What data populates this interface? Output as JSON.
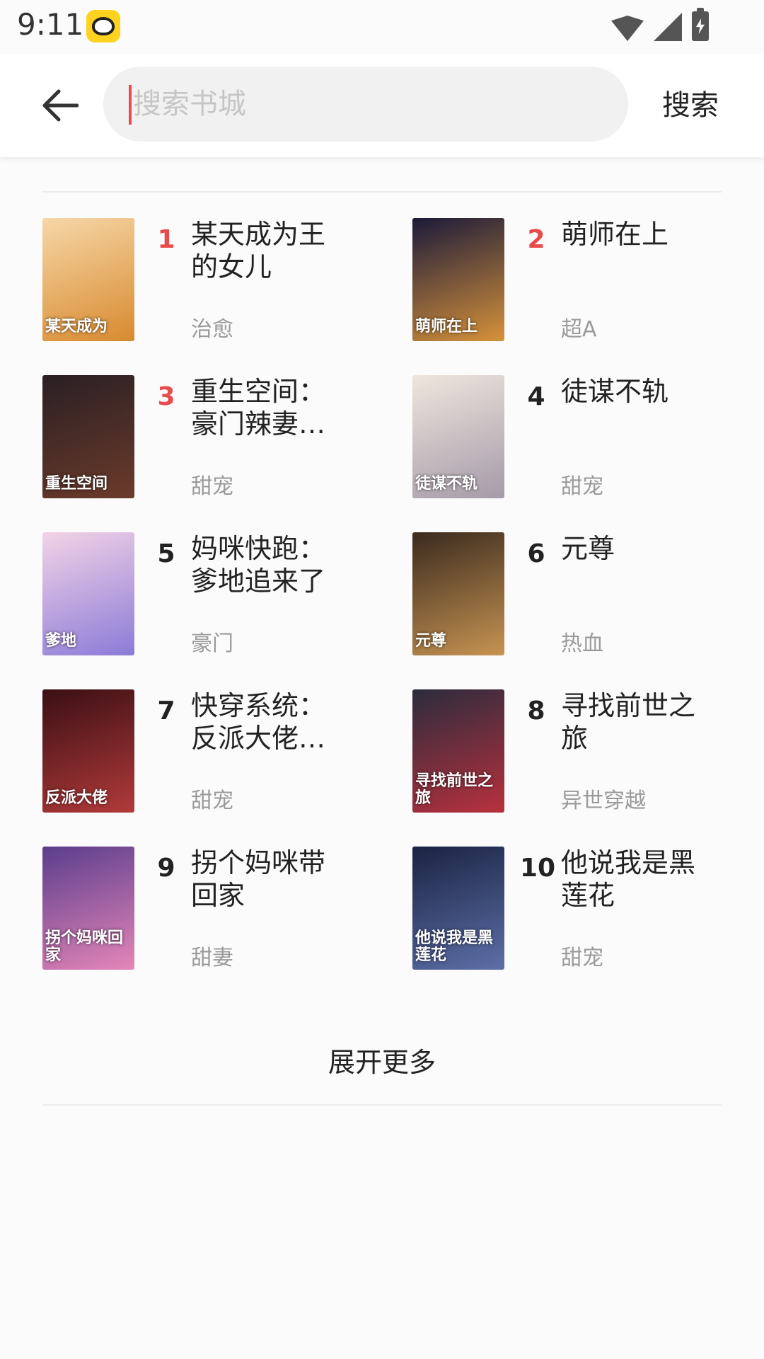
{
  "status_bar": {
    "time": "9:11"
  },
  "header": {
    "search_placeholder": "搜索书城",
    "search_button": "搜索"
  },
  "books": [
    {
      "rank": "1",
      "title": "某天成为王的女儿",
      "tag": "治愈",
      "cover_text": "某天成为",
      "colors": [
        "#f6d7a8",
        "#d88a2e"
      ]
    },
    {
      "rank": "2",
      "title": "萌师在上",
      "tag": "超A",
      "cover_text": "萌师在上",
      "colors": [
        "#1b1a3a",
        "#d6923a"
      ]
    },
    {
      "rank": "3",
      "title": "重生空间：豪门辣妻不…",
      "tag": "甜宠",
      "cover_text": "重生空间",
      "colors": [
        "#2a1f24",
        "#6b3b2a"
      ]
    },
    {
      "rank": "4",
      "title": "徒谋不轨",
      "tag": "甜宠",
      "cover_text": "徒谋不轨",
      "colors": [
        "#efe6de",
        "#a59aa8"
      ]
    },
    {
      "rank": "5",
      "title": "妈咪快跑：爹地追来了",
      "tag": "豪门",
      "cover_text": "爹地",
      "colors": [
        "#f3d3e6",
        "#8b7bd8"
      ]
    },
    {
      "rank": "6",
      "title": "元尊",
      "tag": "热血",
      "cover_text": "元尊",
      "colors": [
        "#3a2a1e",
        "#c79452"
      ]
    },
    {
      "rank": "7",
      "title": "快穿系统：反派大佬不…",
      "tag": "甜宠",
      "cover_text": "反派大佬",
      "colors": [
        "#3a0f14",
        "#b23a3a"
      ]
    },
    {
      "rank": "8",
      "title": "寻找前世之旅",
      "tag": "异世穿越",
      "cover_text": "寻找前世之旅",
      "colors": [
        "#2b2c3d",
        "#b8303d"
      ]
    },
    {
      "rank": "9",
      "title": "拐个妈咪带回家",
      "tag": "甜妻",
      "cover_text": "拐个妈咪回家",
      "colors": [
        "#5a3d8c",
        "#e586b8"
      ]
    },
    {
      "rank": "10",
      "title": "他说我是黑莲花",
      "tag": "甜宠",
      "cover_text": "他说我是黑莲花",
      "colors": [
        "#1a2342",
        "#5d6fa8"
      ]
    }
  ],
  "expand_label": "展开更多",
  "accent": "#e94b4b"
}
